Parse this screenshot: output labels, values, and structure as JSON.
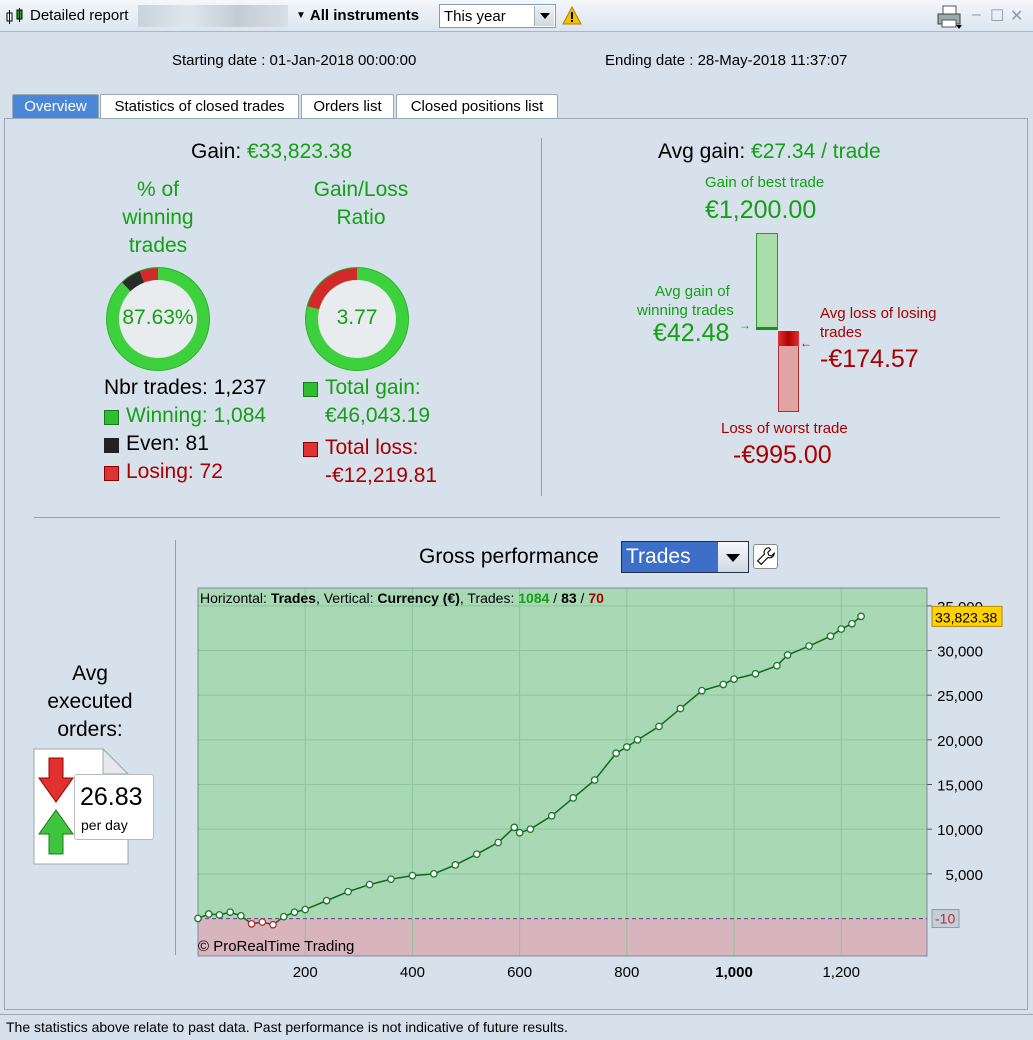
{
  "window": {
    "title": "Detailed report",
    "instrument_label": "All instruments",
    "period_value": "This year"
  },
  "dates": {
    "start": "Starting date : 01-Jan-2018 00:00:00",
    "end": "Ending date : 28-May-2018 11:37:07"
  },
  "tabs": [
    {
      "label": "Overview",
      "active": true
    },
    {
      "label": "Statistics of closed trades",
      "active": false
    },
    {
      "label": "Orders list",
      "active": false
    },
    {
      "label": "Closed positions list",
      "active": false
    }
  ],
  "gain": {
    "label": "Gain:",
    "value": "€33,823.38",
    "pct_title": "% of winning trades",
    "pct_lines": [
      "% of",
      "winning",
      "trades"
    ],
    "pct_value": "87.63%",
    "ratio_lines": [
      "Gain/Loss",
      "Ratio"
    ],
    "ratio_value": "3.77",
    "nbr_label": "Nbr trades: 1,237",
    "winning": "Winning: 1,084",
    "even": "Even: 81",
    "losing": "Losing: 72",
    "total_gain_label": "Total gain:",
    "total_gain_value": "€46,043.19",
    "total_loss_label": "Total loss:",
    "total_loss_value": "-€12,219.81",
    "winning_fraction": 0.8763,
    "even_fraction": 0.0655,
    "losing_fraction": 0.0582,
    "gain_share": 0.7903,
    "loss_share": 0.2097
  },
  "avg": {
    "label": "Avg gain:",
    "value": "€27.34 / trade",
    "best_label": "Gain of best trade",
    "best_value": "€1,200.00",
    "avg_win_label_1": "Avg gain of",
    "avg_win_label_2": "winning trades",
    "avg_win_value": "€42.48",
    "avg_loss_label_1": "Avg loss of losing",
    "avg_loss_label_2": "trades",
    "avg_loss_value": "-€174.57",
    "worst_label": "Loss of worst trade",
    "worst_value": "-€995.00"
  },
  "orders": {
    "lines": [
      "Avg",
      "executed",
      "orders:"
    ],
    "value": "26.83",
    "unit": "per day"
  },
  "performance": {
    "title": "Gross performance",
    "mode": "Trades"
  },
  "colors": {
    "green": "#14a014",
    "red": "#a80000",
    "accent_blue": "#4c86d8",
    "positive_area": "#a9d8b5",
    "negative_area": "#d8b4bd",
    "current_value_bg": "#ffd100"
  },
  "chart_data": {
    "type": "line",
    "header": {
      "h_label": "Horizontal: ",
      "h_value": "Trades",
      "v_label": ", Vertical: ",
      "v_value": "Currency (€)",
      "t_label": ", Trades: ",
      "win": "1084",
      "sep1": " / ",
      "even": "83",
      "sep2": " / ",
      "lose": "70"
    },
    "x_ticks": [
      "200",
      "400",
      "600",
      "800",
      "1,000",
      "1,200"
    ],
    "x_tick_values": [
      200,
      400,
      600,
      800,
      1000,
      1200
    ],
    "y_ticks": [
      "35,000",
      "30,000",
      "25,000",
      "20,000",
      "15,000",
      "10,000",
      "5,000"
    ],
    "y_tick_values": [
      35000,
      30000,
      25000,
      20000,
      15000,
      10000,
      5000
    ],
    "xlim": [
      0,
      1360
    ],
    "ylim": [
      -4200,
      37000
    ],
    "baseline_label": "-10",
    "baseline_value": -10,
    "current_label": "33,823.38",
    "current_value": 33823.38,
    "copyright": "© ProRealTime Trading",
    "series": [
      {
        "x": [
          0,
          20,
          40,
          60,
          80,
          100,
          120,
          140,
          160,
          180,
          200,
          240,
          280,
          320,
          360,
          400,
          440,
          480,
          520,
          560,
          590,
          600,
          620,
          660,
          700,
          740,
          780,
          800,
          820,
          860,
          900,
          940,
          980,
          1000,
          1040,
          1080,
          1100,
          1140,
          1180,
          1200,
          1220,
          1237
        ],
        "y": [
          0,
          500,
          400,
          700,
          300,
          -600,
          -400,
          -700,
          200,
          700,
          1000,
          2000,
          3000,
          3800,
          4400,
          4800,
          5000,
          6000,
          7200,
          8500,
          10200,
          9600,
          10000,
          11500,
          13500,
          15500,
          18500,
          19200,
          20000,
          21500,
          23500,
          25500,
          26200,
          26800,
          27400,
          28300,
          29500,
          30500,
          31600,
          32400,
          33000,
          33823
        ]
      }
    ]
  },
  "status_text": "The statistics above relate to past data. Past performance is not indicative of future results."
}
